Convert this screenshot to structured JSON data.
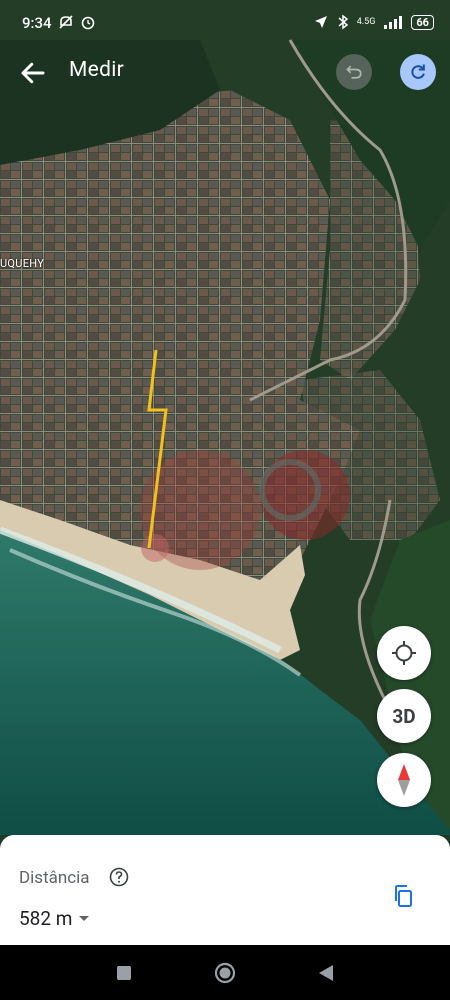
{
  "status_bar": {
    "time": "9:34",
    "network": "4.5G",
    "battery": "66"
  },
  "header": {
    "title": "Medir"
  },
  "map": {
    "place_label": "UQUEHY",
    "route_color": "#f2c21b"
  },
  "controls": {
    "three_d_label": "3D"
  },
  "bottom_sheet": {
    "label": "Distância",
    "value": "582 m"
  },
  "colors": {
    "accent": "#a8c7fa",
    "copy_icon": "#1a73e8",
    "compass_red": "#e53935"
  }
}
